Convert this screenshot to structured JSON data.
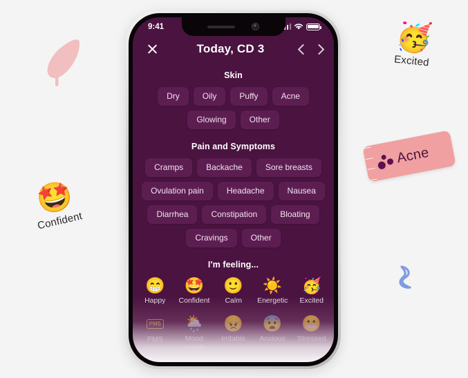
{
  "page": {
    "background_color": "#f5f4f4"
  },
  "stickers": {
    "feather": {
      "name": "feather-blob",
      "color": "#f0bcbc"
    },
    "confident": {
      "emoji": "🤩",
      "label": "Confident"
    },
    "excited": {
      "emoji": "🥳",
      "label": "Excited"
    },
    "acne_ticket": {
      "label": "Acne",
      "color": "#f0a0a0",
      "dot_color": "#5b1150"
    },
    "ribbon": {
      "name": "ribbon-shape",
      "color": "#7d9ce0"
    }
  },
  "phone": {
    "status_bar": {
      "time": "9:41",
      "icons": [
        "signal-icon",
        "wifi-icon",
        "battery-icon"
      ]
    },
    "nav": {
      "close_icon": "close-icon",
      "title": "Today, CD 3",
      "prev_icon": "chevron-left-icon",
      "next_icon": "chevron-right-icon"
    },
    "screen_background": "#4a1340",
    "chip_background": "#5c1e51",
    "sections": [
      {
        "title": "Skin",
        "rows": [
          [
            "Dry",
            "Oily",
            "Puffy",
            "Acne"
          ],
          [
            "Glowing",
            "Other"
          ]
        ]
      },
      {
        "title": "Pain and Symptoms",
        "rows": [
          [
            "Cramps",
            "Backache",
            "Sore breasts"
          ],
          [
            "Ovulation pain",
            "Headache",
            "Nausea"
          ],
          [
            "Diarrhea",
            "Constipation",
            "Bloating"
          ],
          [
            "Cravings",
            "Other"
          ]
        ]
      }
    ],
    "feelings": {
      "title": "I'm feeling...",
      "rows": [
        [
          {
            "emoji": "😁",
            "label": "Happy"
          },
          {
            "emoji": "🤩",
            "label": "Confident"
          },
          {
            "emoji": "🙂",
            "label": "Calm"
          },
          {
            "emoji": "☀️",
            "label": "Energetic"
          },
          {
            "emoji": "🥳",
            "label": "Excited"
          }
        ],
        [
          {
            "emoji": "PMS",
            "label": "PMS",
            "badge": true
          },
          {
            "emoji": "🌦️",
            "label": "Mood swings"
          },
          {
            "emoji": "😠",
            "label": "Irritable"
          },
          {
            "emoji": "😨",
            "label": "Anxious"
          },
          {
            "emoji": "😬",
            "label": "Stressed"
          }
        ]
      ]
    }
  }
}
